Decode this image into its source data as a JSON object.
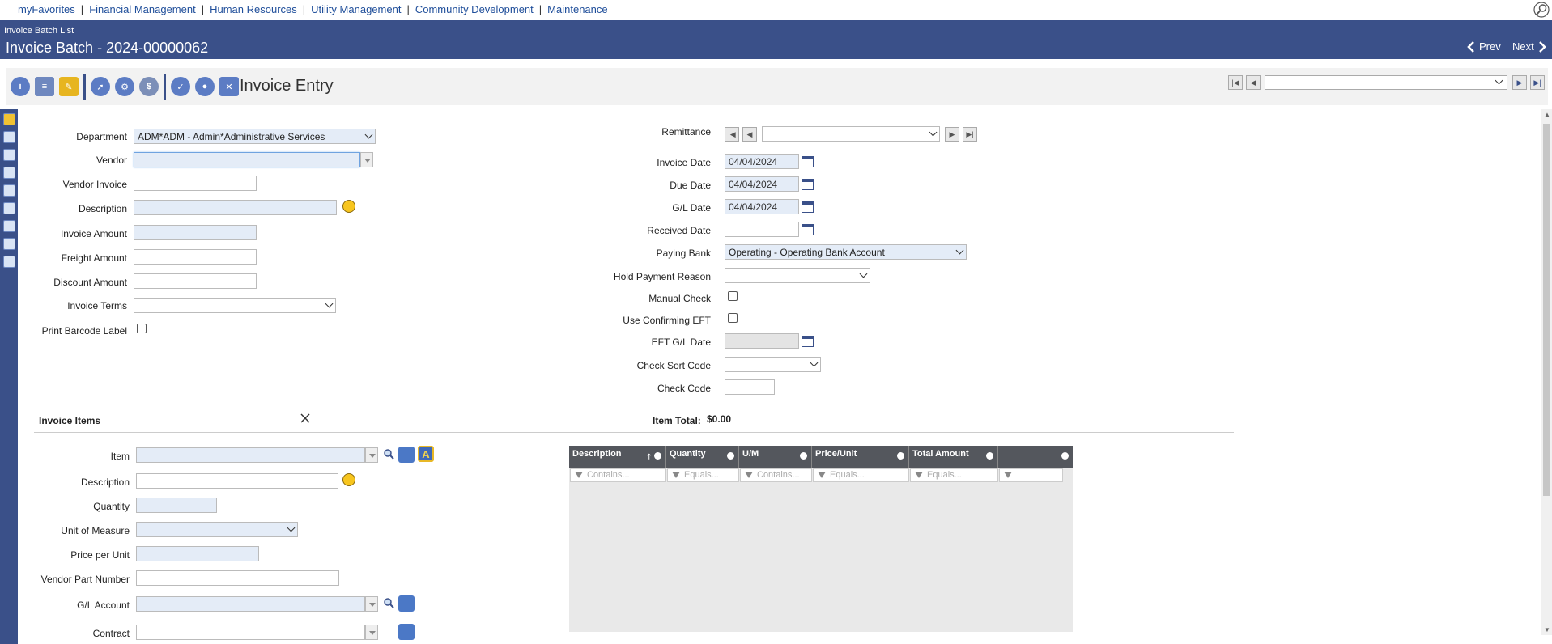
{
  "topnav": {
    "items": [
      "myFavorites",
      "Financial Management",
      "Human Resources",
      "Utility Management",
      "Community Development",
      "Maintenance"
    ]
  },
  "header": {
    "breadcrumb": "Invoice Batch List",
    "title": "Invoice Batch - 2024-00000062",
    "prev_label": "Prev",
    "next_label": "Next"
  },
  "toolbar": {
    "title": "Invoice Entry"
  },
  "form": {
    "department": {
      "label": "Department",
      "value": "ADM*ADM - Admin*Administrative Services"
    },
    "vendor": {
      "label": "Vendor",
      "value": ""
    },
    "vendor_invoice": {
      "label": "Vendor Invoice",
      "value": ""
    },
    "description": {
      "label": "Description",
      "value": ""
    },
    "invoice_amount": {
      "label": "Invoice Amount",
      "value": ""
    },
    "freight_amount": {
      "label": "Freight Amount",
      "value": ""
    },
    "discount_amount": {
      "label": "Discount Amount",
      "value": ""
    },
    "invoice_terms": {
      "label": "Invoice Terms",
      "value": ""
    },
    "print_barcode": {
      "label": "Print Barcode Label"
    },
    "remittance": {
      "label": "Remittance",
      "value": ""
    },
    "invoice_date": {
      "label": "Invoice Date",
      "value": "04/04/2024"
    },
    "due_date": {
      "label": "Due Date",
      "value": "04/04/2024"
    },
    "gl_date": {
      "label": "G/L Date",
      "value": "04/04/2024"
    },
    "received_date": {
      "label": "Received Date",
      "value": ""
    },
    "paying_bank": {
      "label": "Paying Bank",
      "value": "Operating - Operating Bank Account"
    },
    "hold_payment_reason": {
      "label": "Hold Payment Reason",
      "value": ""
    },
    "manual_check": {
      "label": "Manual Check"
    },
    "use_confirming_eft": {
      "label": "Use Confirming EFT"
    },
    "eft_gl_date": {
      "label": "EFT G/L Date",
      "value": ""
    },
    "check_sort_code": {
      "label": "Check Sort Code",
      "value": ""
    },
    "check_code": {
      "label": "Check Code",
      "value": ""
    }
  },
  "items_section": {
    "title": "Invoice Items",
    "item_total_label": "Item Total:",
    "item_total_value": "$0.00",
    "item": {
      "label": "Item",
      "value": ""
    },
    "description": {
      "label": "Description",
      "value": ""
    },
    "quantity": {
      "label": "Quantity",
      "value": ""
    },
    "unit_of_measure": {
      "label": "Unit of Measure",
      "value": ""
    },
    "price_per_unit": {
      "label": "Price per Unit",
      "value": ""
    },
    "vendor_part_number": {
      "label": "Vendor Part Number",
      "value": ""
    },
    "gl_account": {
      "label": "G/L Account",
      "value": ""
    },
    "contract": {
      "label": "Contract",
      "value": ""
    }
  },
  "grid": {
    "columns": [
      {
        "label": "Description",
        "filter": "Contains..."
      },
      {
        "label": "Quantity",
        "filter": "Equals..."
      },
      {
        "label": "U/M",
        "filter": "Contains..."
      },
      {
        "label": "Price/Unit",
        "filter": "Equals..."
      },
      {
        "label": "Total Amount",
        "filter": "Equals..."
      },
      {
        "label": "",
        "filter": ""
      }
    ]
  },
  "colors": {
    "header_bg": "#3a5089",
    "required_field_bg": "#e4ecf7",
    "grid_header_bg": "#54575d",
    "link": "#1f4e9a"
  }
}
